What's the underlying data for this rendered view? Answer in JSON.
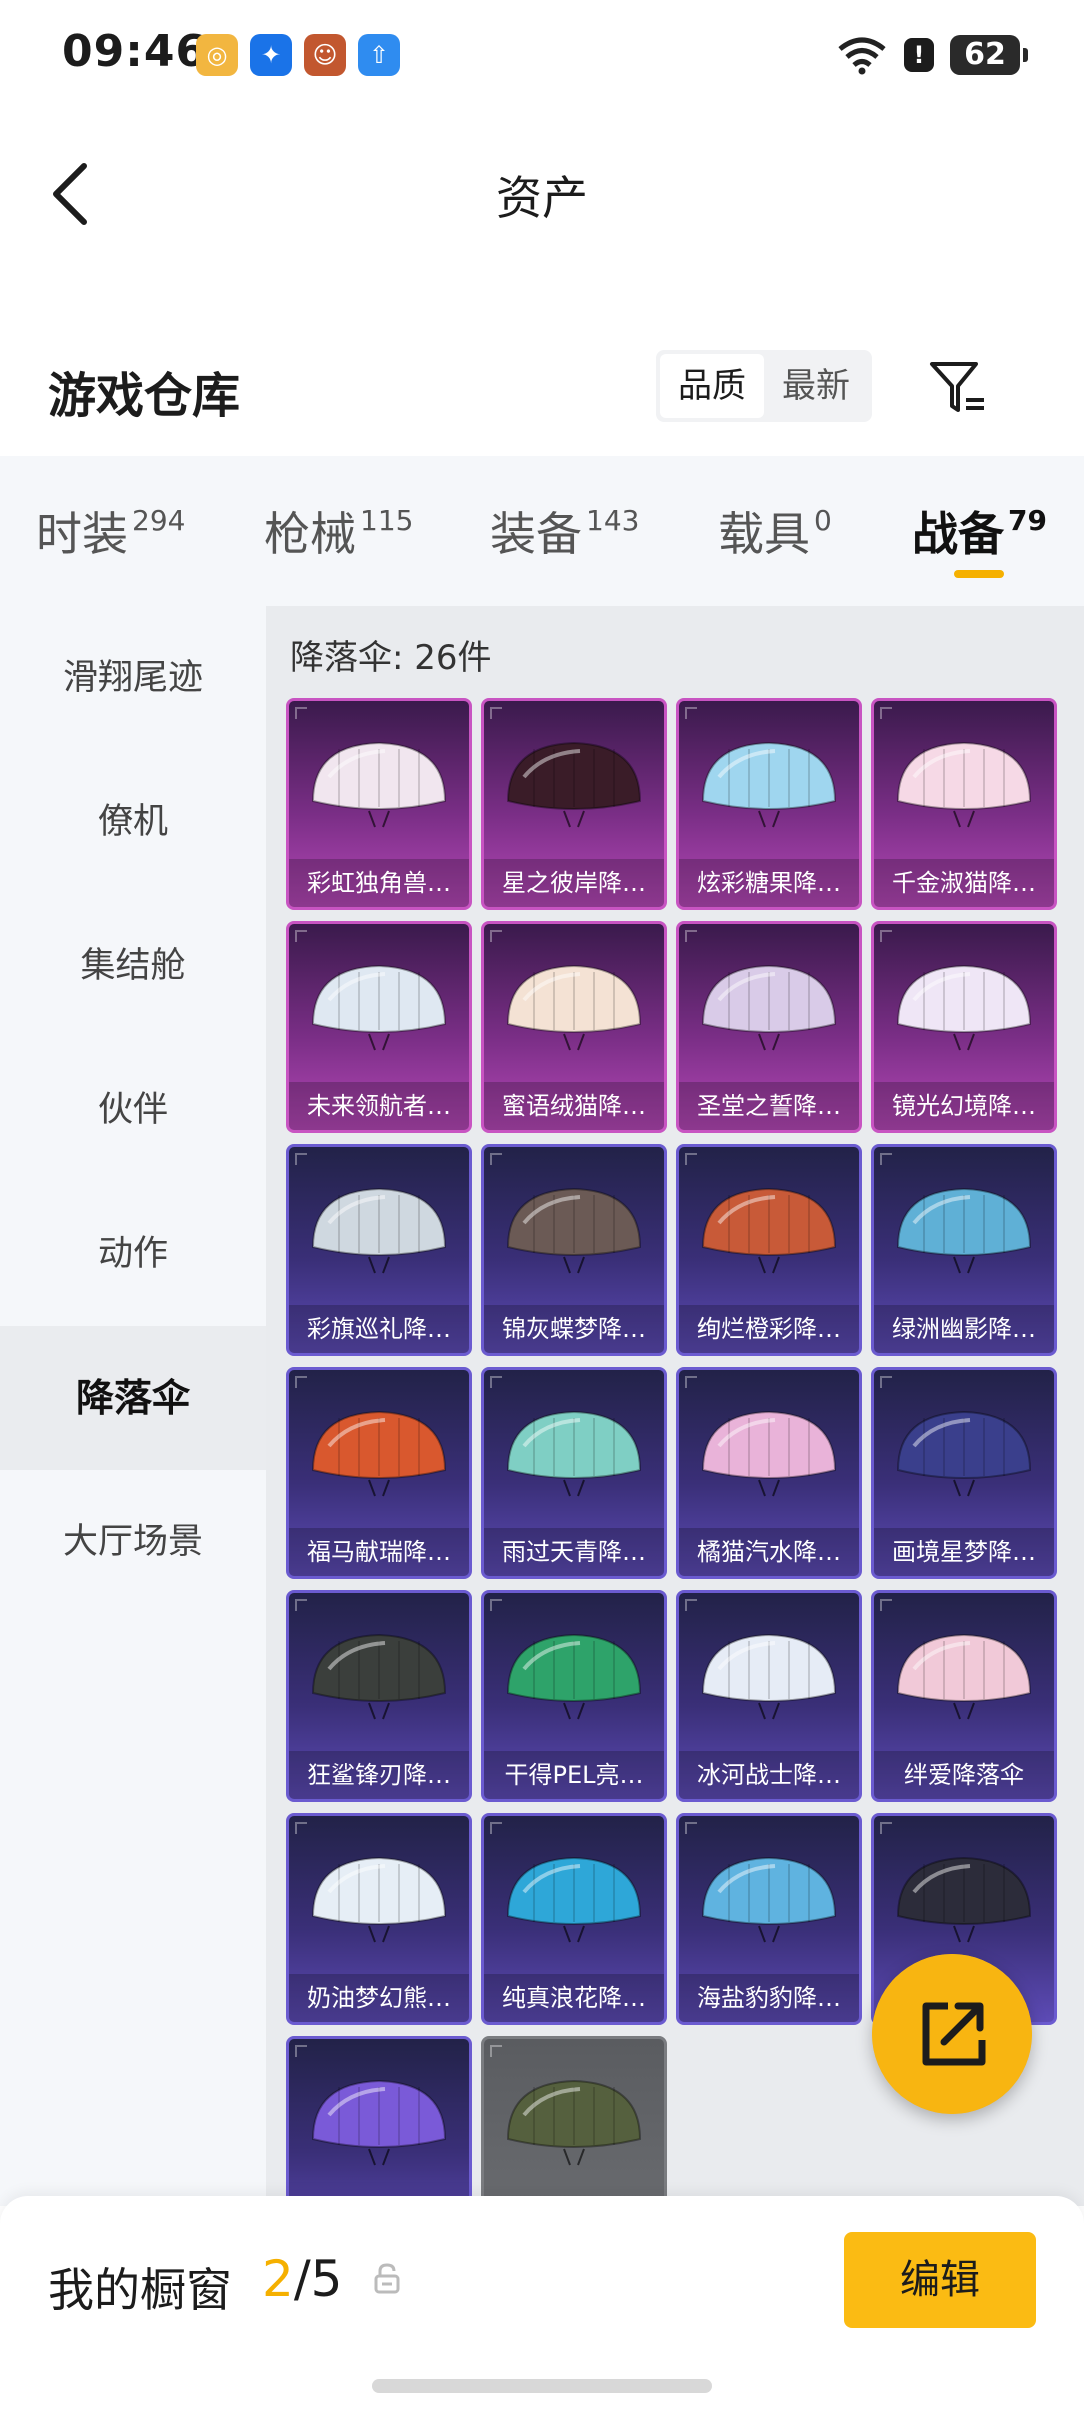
{
  "status_bar": {
    "time": "09:46",
    "battery": "62",
    "apps": [
      {
        "icon": "target-app-icon",
        "color": "#f2b640"
      },
      {
        "icon": "lightbulb-app-icon",
        "color": "#1a73e8"
      },
      {
        "icon": "game-avatar-app-icon",
        "color": "#c2572f"
      },
      {
        "icon": "upload-app-icon",
        "color": "#2f8cf0"
      }
    ]
  },
  "header": {
    "title": "资产"
  },
  "section": {
    "title": "游戏仓库",
    "sort_options": [
      "品质",
      "最新"
    ],
    "active_sort": "品质"
  },
  "tabs": [
    {
      "label": "时装",
      "count": "294"
    },
    {
      "label": "枪械",
      "count": "115"
    },
    {
      "label": "装备",
      "count": "143"
    },
    {
      "label": "载具",
      "count": "0"
    },
    {
      "label": "战备",
      "count": "79",
      "active": true
    }
  ],
  "sidebar": {
    "items": [
      "滑翔尾迹",
      "僚机",
      "集结舱",
      "伙伴",
      "动作",
      "降落伞",
      "大厅场景"
    ],
    "active": "降落伞"
  },
  "grid": {
    "count_label": "降落伞: 26件",
    "items": [
      {
        "name": "彩虹独角兽…",
        "rarity": "purple",
        "color": "#f1e6ef"
      },
      {
        "name": "星之彼岸降…",
        "rarity": "purple",
        "color": "#3a1c28"
      },
      {
        "name": "炫彩糖果降…",
        "rarity": "purple",
        "color": "#9fd6ef"
      },
      {
        "name": "千金淑猫降…",
        "rarity": "purple",
        "color": "#f6d9e6"
      },
      {
        "name": "未来领航者…",
        "rarity": "purple",
        "color": "#dfe8f2"
      },
      {
        "name": "蜜语绒猫降…",
        "rarity": "purple",
        "color": "#f4e2d4"
      },
      {
        "name": "圣堂之誓降…",
        "rarity": "purple",
        "color": "#d9cbe8"
      },
      {
        "name": "镜光幻境降…",
        "rarity": "purple",
        "color": "#efe6f6"
      },
      {
        "name": "彩旗巡礼降…",
        "rarity": "blue",
        "color": "#cfd8e0"
      },
      {
        "name": "锦灰蝶梦降…",
        "rarity": "blue",
        "color": "#6b5a55"
      },
      {
        "name": "绚烂橙彩降…",
        "rarity": "blue",
        "color": "#c85a38"
      },
      {
        "name": "绿洲幽影降…",
        "rarity": "blue",
        "color": "#5fb0d6"
      },
      {
        "name": "福马献瑞降…",
        "rarity": "blue",
        "color": "#d9582e"
      },
      {
        "name": "雨过天青降…",
        "rarity": "blue",
        "color": "#7fcfc4"
      },
      {
        "name": "橘猫汽水降…",
        "rarity": "blue",
        "color": "#e9b3d9"
      },
      {
        "name": "画境星梦降…",
        "rarity": "blue",
        "color": "#3a3f8c"
      },
      {
        "name": "狂鲨锋刃降…",
        "rarity": "blue",
        "color": "#3b3f3c"
      },
      {
        "name": "干得PEL亮…",
        "rarity": "blue",
        "color": "#2ea36a"
      },
      {
        "name": "冰河战士降…",
        "rarity": "blue",
        "color": "#e6ecf6"
      },
      {
        "name": "绊爱降落伞",
        "rarity": "blue",
        "color": "#f1c9d8"
      },
      {
        "name": "奶油梦幻熊…",
        "rarity": "blue",
        "color": "#e6eef6"
      },
      {
        "name": "纯真浪花降…",
        "rarity": "blue",
        "color": "#2ea7d8"
      },
      {
        "name": "海盐豹豹降…",
        "rarity": "blue",
        "color": "#5fb3e0"
      },
      {
        "name": "",
        "rarity": "blue",
        "color": "#2c2c3a"
      },
      {
        "name": "",
        "rarity": "blue",
        "color": "#7a5ad8"
      },
      {
        "name": "",
        "rarity": "gray",
        "color": "#55603e"
      }
    ]
  },
  "bottom_bar": {
    "label": "我的橱窗",
    "current": "2",
    "total": "/5",
    "edit_label": "编辑"
  },
  "colors": {
    "accent": "#f5b000",
    "purple_tier": "#b548b7",
    "blue_tier": "#5d4bb6"
  }
}
